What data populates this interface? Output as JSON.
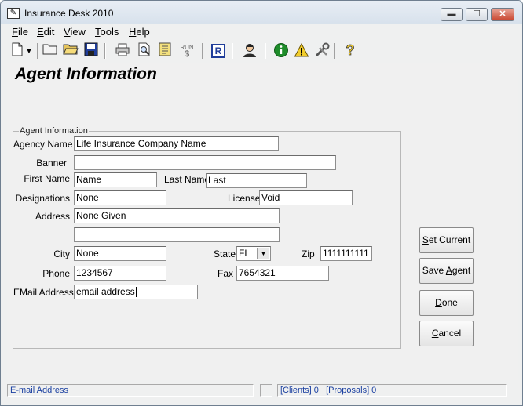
{
  "window": {
    "title": "Insurance Desk 2010"
  },
  "window_controls": {
    "minimize": "▬",
    "maximize": "☐",
    "close": "✕"
  },
  "menu": [
    {
      "key": "F",
      "rest": "ile"
    },
    {
      "key": "E",
      "rest": "dit"
    },
    {
      "key": "V",
      "rest": "iew"
    },
    {
      "key": "T",
      "rest": "ools"
    },
    {
      "key": "H",
      "rest": "elp"
    }
  ],
  "toolbar": {
    "icons": [
      "new-document-icon",
      "dropdown-arrow-icon",
      "open-folder-icon",
      "open-file-icon",
      "save-icon",
      "print-icon",
      "print-preview-icon",
      "report-icon",
      "run-icon",
      "r-icon",
      "agent-icon",
      "info-icon",
      "warning-icon",
      "tools-icon",
      "help-icon"
    ],
    "run_label": "RUN",
    "run_symbol": "$",
    "r_label": "R"
  },
  "page": {
    "title": "Agent Information"
  },
  "group": {
    "legend": "Agent Information"
  },
  "labels": {
    "agency_name": "Agency Name",
    "banner": "Banner",
    "first_name": "First Name",
    "last_name": "Last Name",
    "designations": "Designations",
    "license": "License",
    "address": "Address",
    "city": "City",
    "state": "State",
    "zip": "Zip",
    "phone": "Phone",
    "fax": "Fax",
    "email": "EMail Address"
  },
  "fields": {
    "agency_name": "Life Insurance Company Name",
    "banner": "",
    "first_name": "Name",
    "last_name": "Last",
    "designations": "None",
    "license": "Void",
    "address1": "None Given",
    "address2": "",
    "city": "None",
    "state": "FL",
    "zip": "1111111111",
    "phone": "1234567",
    "fax": "7654321",
    "email": "email address"
  },
  "buttons": {
    "set_current": {
      "key": "S",
      "rest": "et Current"
    },
    "save_agent": {
      "pre": "Save ",
      "key": "A",
      "rest": "gent"
    },
    "done": {
      "key": "D",
      "rest": "one"
    },
    "cancel": {
      "key": "C",
      "rest": "ancel"
    }
  },
  "status": {
    "message": "E-mail Address",
    "clients": "[Clients] 0",
    "proposals": "[Proposals] 0"
  },
  "colors": {
    "status_text": "#1a3fa0",
    "title_bar": "#dbe4ee",
    "close_button": "#c9452f"
  }
}
